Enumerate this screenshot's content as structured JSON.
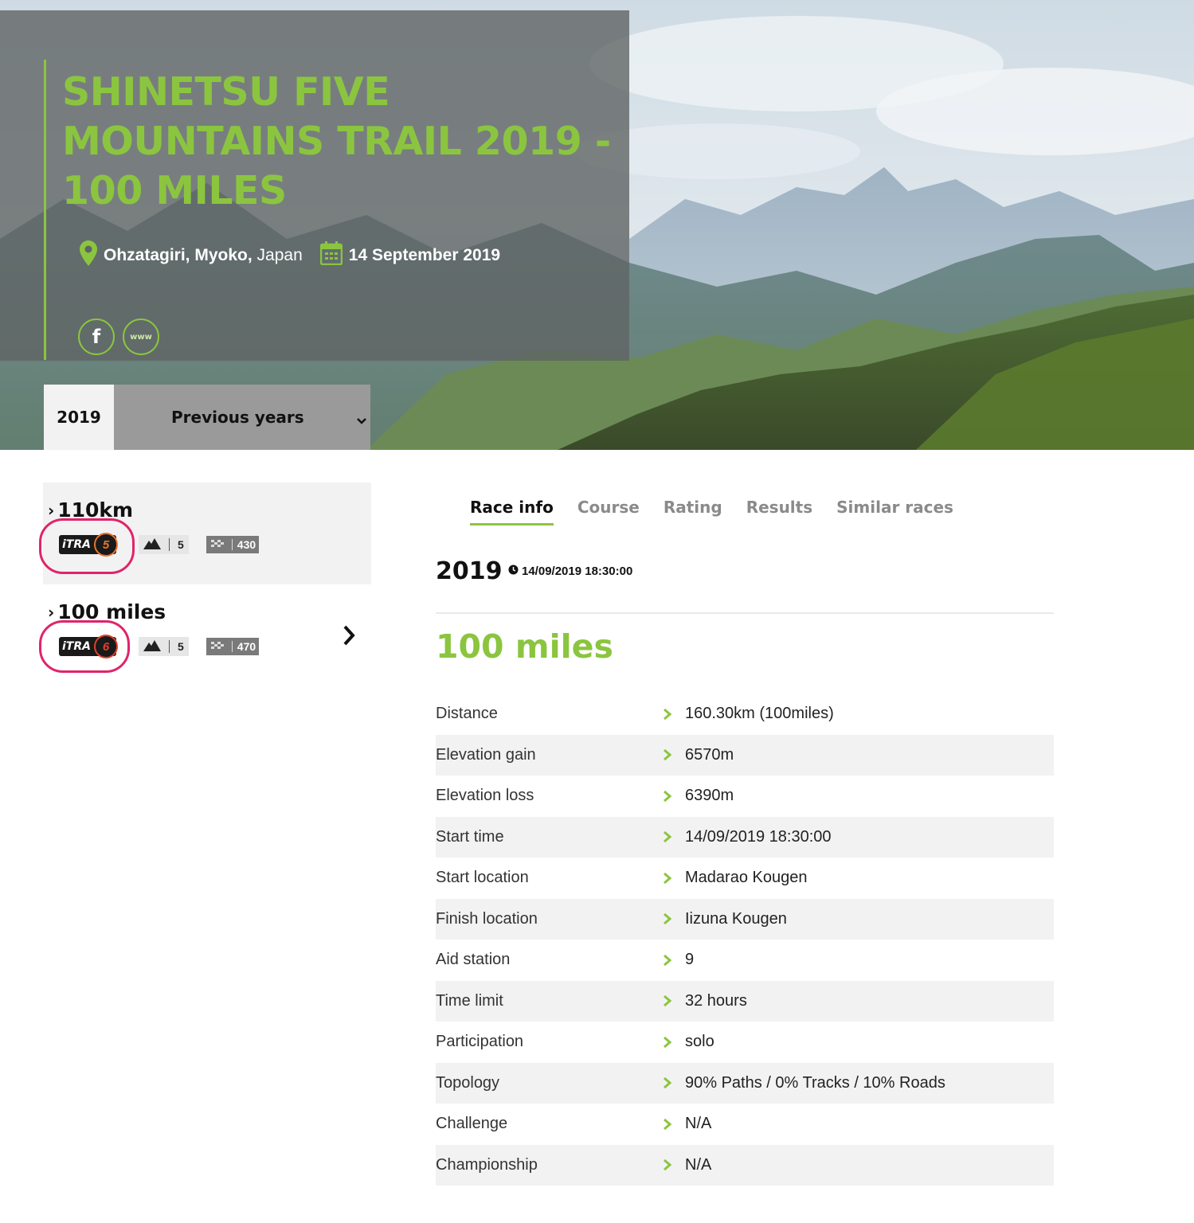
{
  "header": {
    "title": "SHINETSU FIVE MOUNTAINS TRAIL 2019 - 100 MILES",
    "location_bold": "Ohzatagiri, Myoko,",
    "location_country": "Japan",
    "date": "14 September 2019",
    "social": {
      "facebook_label": "f",
      "website_label": "www"
    }
  },
  "year_tabs": {
    "current": "2019",
    "previous": "Previous years"
  },
  "races": [
    {
      "name": "110km",
      "itra_label": "iTRA",
      "itra_points": "5",
      "mountain_level": "5",
      "finishers": "430",
      "active": true
    },
    {
      "name": "100 miles",
      "itra_label": "iTRA",
      "itra_points": "6",
      "mountain_level": "5",
      "finishers": "470",
      "active": false
    }
  ],
  "tabs": [
    "Race info",
    "Course",
    "Rating",
    "Results",
    "Similar races"
  ],
  "edition": {
    "year": "2019",
    "datetime": "14/09/2019 18:30:00"
  },
  "distance_title": "100 miles",
  "info": [
    {
      "label": "Distance",
      "value": "160.30km (100miles)"
    },
    {
      "label": "Elevation gain",
      "value": "6570m"
    },
    {
      "label": "Elevation loss",
      "value": "6390m"
    },
    {
      "label": "Start time",
      "value": "14/09/2019 18:30:00"
    },
    {
      "label": "Start location",
      "value": "Madarao Kougen"
    },
    {
      "label": "Finish location",
      "value": "Iizuna Kougen"
    },
    {
      "label": "Aid station",
      "value": "9"
    },
    {
      "label": "Time limit",
      "value": "32 hours"
    },
    {
      "label": "Participation",
      "value": "solo"
    },
    {
      "label": "Topology",
      "value": "90% Paths / 0% Tracks / 10% Roads"
    },
    {
      "label": "Challenge",
      "value": "N/A"
    },
    {
      "label": "Championship",
      "value": "N/A"
    }
  ],
  "colors": {
    "accent": "#8bc53f",
    "highlight": "#e0246a",
    "itra_orange": "#e8742a",
    "itra_red": "#e0402a"
  }
}
